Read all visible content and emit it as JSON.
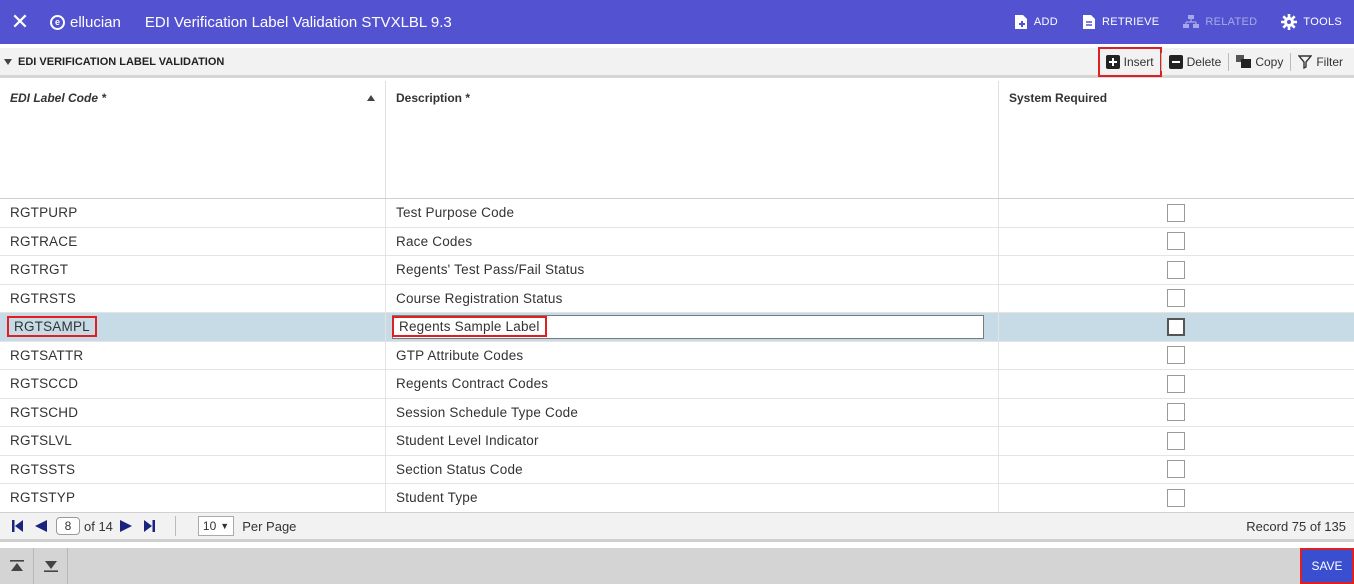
{
  "topbar": {
    "brand": "ellucian",
    "title": "EDI Verification Label Validation STVXLBL 9.3",
    "actions": {
      "add": "ADD",
      "retrieve": "RETRIEVE",
      "related": "RELATED",
      "tools": "TOOLS"
    },
    "colors": {
      "bar": "#5353d2",
      "disabled": "#a8a8e8"
    }
  },
  "section": {
    "title": "EDI VERIFICATION LABEL VALIDATION",
    "actions": {
      "insert": "Insert",
      "delete": "Delete",
      "copy": "Copy",
      "filter": "Filter"
    }
  },
  "table": {
    "columns": {
      "code": "EDI Label Code *",
      "description": "Description *",
      "system_required": "System Required"
    },
    "rows": [
      {
        "code": "RGTPURP",
        "description": "Test Purpose Code"
      },
      {
        "code": "RGTRACE",
        "description": "Race Codes"
      },
      {
        "code": "RGTRGT",
        "description": "Regents' Test Pass/Fail Status"
      },
      {
        "code": "RGTRSTS",
        "description": "Course Registration Status"
      },
      {
        "code": "RGTSAMPL",
        "description": "Regents Sample Label"
      },
      {
        "code": "RGTSATTR",
        "description": "GTP Attribute Codes"
      },
      {
        "code": "RGTSCCD",
        "description": "Regents Contract Codes"
      },
      {
        "code": "RGTSCHD",
        "description": "Session Schedule Type Code"
      },
      {
        "code": "RGTSLVL",
        "description": "Student Level Indicator"
      },
      {
        "code": "RGTSSTS",
        "description": "Section Status Code"
      },
      {
        "code": "RGTSTYP",
        "description": "Student Type"
      }
    ]
  },
  "pager": {
    "current_page": "8",
    "of_pages": "of 14",
    "per_page_value": "10",
    "per_page_label": "Per Page",
    "record_text": "Record 75 of 135"
  },
  "bottombar": {
    "save": "SAVE"
  }
}
